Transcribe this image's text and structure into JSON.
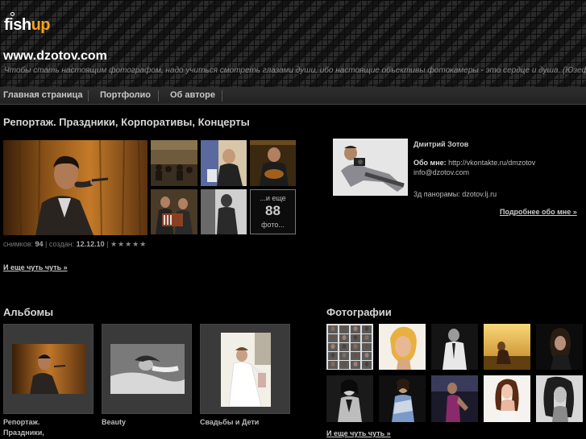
{
  "header": {
    "logo_text_1": "fish",
    "logo_text_2": "up",
    "site_title": "www.dzotov.com",
    "tagline": "Чтобы стать настоящим фотографом, надо учиться смотреть глазами души, ибо настоящие объективы фотокамеры - это сердце и душа. (Юзеф Карш)"
  },
  "nav": {
    "items": [
      "Главная страница",
      "Портфолио",
      "Об авторе"
    ]
  },
  "album_feature": {
    "title": "Репортаж. Праздники, Корпоративы, Концерты",
    "more_prefix": "...и еще",
    "more_count": "88",
    "more_suffix": "фото...",
    "stats": {
      "photos_label": "снимков:",
      "photos_value": "94",
      "created_label": "создан:",
      "created_value": "12.12.10",
      "stars": "★★★★★"
    },
    "read_more": "И еще чуть чуть »"
  },
  "profile": {
    "name": "Дмитрий Зотов",
    "about_label": "Обо мне:",
    "about_link": "http://vkontakte.ru/dmzotov",
    "email": "info@dzotov.com",
    "panorama": "3д панорамы: dzotov.lj.ru",
    "more_link": "Подробнее обо мне »"
  },
  "albums": {
    "heading": "Альбомы",
    "items": [
      {
        "label_line1": "Репортаж.",
        "label_line2": "Праздники,"
      },
      {
        "label_line1": "Beauty",
        "label_line2": ""
      },
      {
        "label_line1": "Свадьбы и Дети",
        "label_line2": ""
      }
    ]
  },
  "photos": {
    "heading": "Фотографии",
    "more_link": "И еще чуть чуть »"
  },
  "colors": {
    "background": "#000000",
    "logo_accent": "#f7a21b",
    "header_tile": "#1e1e1e"
  }
}
